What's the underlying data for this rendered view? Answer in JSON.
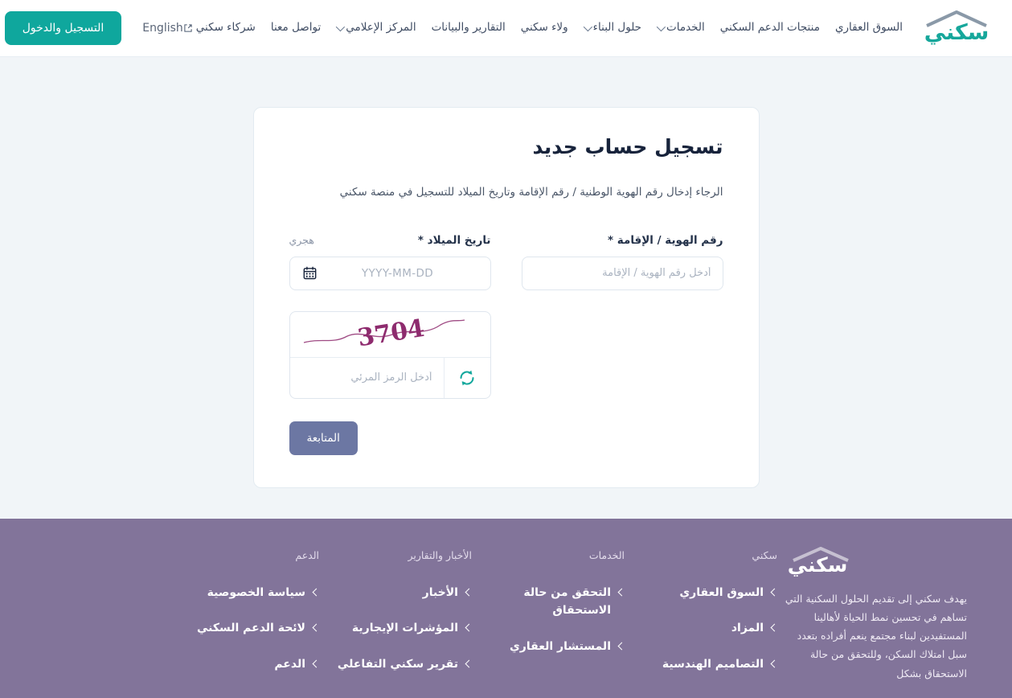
{
  "colors": {
    "brand_teal": "#0fa79d",
    "page_bg": "#f1f5f8",
    "footer_bg": "#82749a",
    "submit_btn": "#6c77a3",
    "captcha_text": "#8e2b6e"
  },
  "header": {
    "logo_text": "سكني",
    "nav_items": [
      {
        "label": "السوق العقاري",
        "icon": "",
        "has_caret": false
      },
      {
        "label": "منتجات الدعم السكني",
        "icon": "",
        "has_caret": false
      },
      {
        "label": "الخدمات",
        "icon": "chevron-down-icon",
        "has_caret": true
      },
      {
        "label": "حلول البناء",
        "icon": "chevron-down-icon",
        "has_caret": true
      },
      {
        "label": "ولاء سكني",
        "icon": "",
        "has_caret": false
      },
      {
        "label": "التقارير والبيانات",
        "icon": "",
        "has_caret": false
      },
      {
        "label": "المركز الإعلامي",
        "icon": "chevron-down-icon",
        "has_caret": true
      },
      {
        "label": "تواصل معنا",
        "icon": "",
        "has_caret": false
      },
      {
        "label": "شركاء سكني",
        "icon": "external-link-icon",
        "has_caret": false
      }
    ],
    "language_label": "English",
    "login_label": "التسجيل والدخول"
  },
  "card": {
    "title": "تسجيل حساب جديد",
    "subtitle": "الرجاء إدخال رقم الهوية الوطنية / رقم الإقامة وتاريخ الميلاد للتسجيل في منصة سكني",
    "id_field": {
      "label": "رقم الهوية / الإقامة",
      "required_mark": "*",
      "placeholder": "أدخل رقم الهوية / الإقامة",
      "value": ""
    },
    "birth_field": {
      "label": "تاريخ الميلاد",
      "required_mark": "*",
      "placeholder": "YYYY-MM-DD",
      "value": "",
      "hijri_toggle": "هجري",
      "icon": "calendar-icon"
    },
    "captcha": {
      "code_text": "3704",
      "refresh_icon": "refresh-icon",
      "placeholder": "أدخل الرمز المرئي",
      "value": ""
    },
    "submit_label": "المتابعة"
  },
  "footer": {
    "logo_text": "سكني",
    "description": "يهدف سكني إلى تقديم الحلول السكنية التي تساهم في تحسين نمط الحياة لأهالينا المستفيدين لبناء مجتمع ينعم أفراده بتعدد سبل امتلاك السكن، وللتحقق من حالة الاستحقاق بشكل",
    "columns": [
      {
        "title": "سكني",
        "links": [
          "السوق العقاري",
          "المزاد",
          "التصاميم الهندسية"
        ]
      },
      {
        "title": "الخدمات",
        "links": [
          "التحقق من حالة الاستحقاق",
          "المستشار العقاري"
        ]
      },
      {
        "title": "الأخبار والتقارير",
        "links": [
          "الأخبار",
          "المؤشرات الإيجارية",
          "تقرير سكني التفاعلي"
        ]
      },
      {
        "title": "الدعم",
        "links": [
          "سياسة الخصوصية",
          "لائحة الدعم السكني",
          "الدعم"
        ]
      }
    ]
  }
}
